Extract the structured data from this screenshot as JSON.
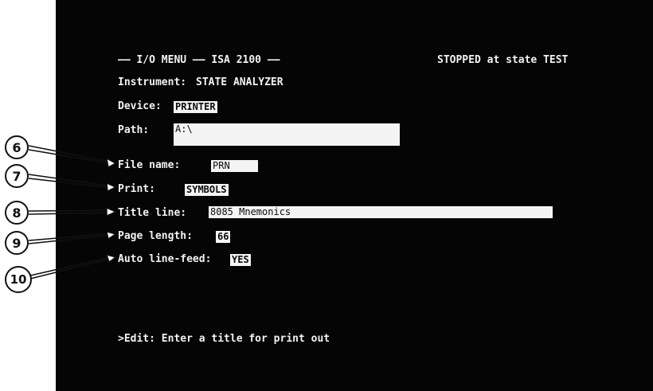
{
  "menu_header": "—— I/O MENU —— ISA 2100 ——",
  "status": "STOPPED at state TEST",
  "instrument": {
    "label": "Instrument:",
    "value": "STATE ANALYZER"
  },
  "device": {
    "label": "Device:",
    "value": "PRINTER"
  },
  "path": {
    "label": "Path:",
    "value": "A:\\"
  },
  "file_name": {
    "label": "File name:",
    "value": "PRN"
  },
  "print": {
    "label": "Print:",
    "value": "SYMBOLS"
  },
  "title_line": {
    "label": "Title line:",
    "value": "8085 Mnemonics"
  },
  "page_length": {
    "label": "Page length:",
    "value": "66"
  },
  "auto_line_feed": {
    "label": "Auto line-feed:",
    "value": "YES"
  },
  "prompt": ">Edit: Enter a title for print out",
  "callouts": [
    "6",
    "7",
    "8",
    "9",
    "10"
  ]
}
